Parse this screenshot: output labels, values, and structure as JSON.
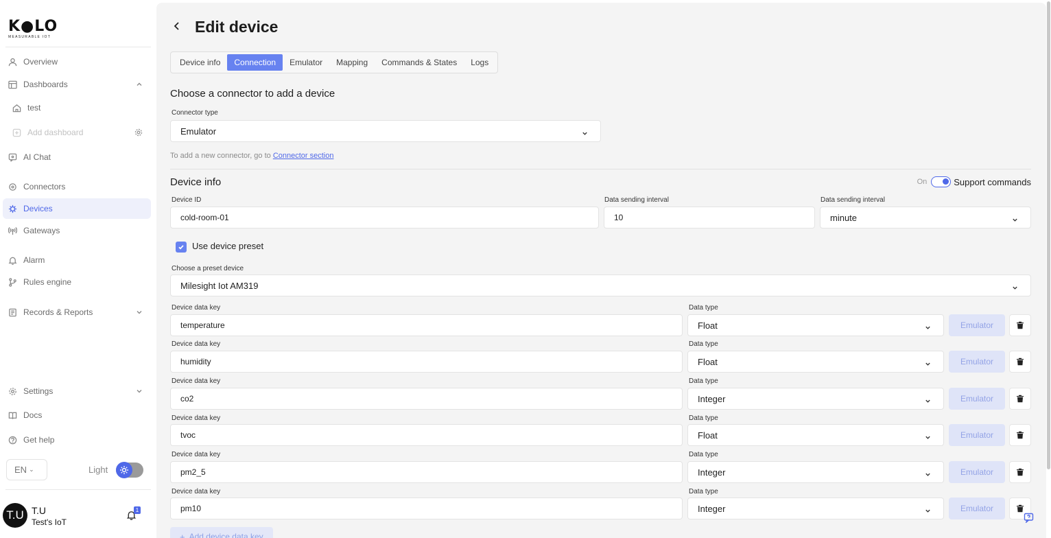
{
  "brand": {
    "name": "K●LO",
    "tagline": "MEASURABLE IOT"
  },
  "sidebar": {
    "items": [
      {
        "label": "Overview",
        "icon": "user-icon"
      },
      {
        "label": "Dashboards",
        "icon": "layout-icon"
      },
      {
        "label": "test",
        "icon": "home-icon"
      },
      {
        "label": "Add dashboard",
        "icon": "plus-square-icon"
      },
      {
        "label": "AI Chat",
        "icon": "chat-icon"
      },
      {
        "label": "Connectors",
        "icon": "link-icon"
      },
      {
        "label": "Devices",
        "icon": "chip-icon"
      },
      {
        "label": "Gateways",
        "icon": "antenna-icon"
      },
      {
        "label": "Alarm",
        "icon": "bell-icon"
      },
      {
        "label": "Rules engine",
        "icon": "branch-icon"
      },
      {
        "label": "Records & Reports",
        "icon": "report-icon"
      },
      {
        "label": "Settings",
        "icon": "gear-icon"
      },
      {
        "label": "Docs",
        "icon": "book-icon"
      },
      {
        "label": "Get help",
        "icon": "help-icon"
      }
    ],
    "language": "EN",
    "theme_label": "Light",
    "user": {
      "initials": "T.U",
      "name": "T.U",
      "org": "Test's IoT",
      "notifications": "1"
    }
  },
  "page": {
    "title": "Edit device"
  },
  "tabs": [
    "Device info",
    "Connection",
    "Emulator",
    "Mapping",
    "Commands & States",
    "Logs"
  ],
  "active_tab": "Connection",
  "connector": {
    "heading": "Choose a connector to add a device",
    "type_label": "Connector type",
    "type_value": "Emulator",
    "hint_prefix": "To add a new connector, go to ",
    "hint_link": "Connector section"
  },
  "device_info": {
    "heading": "Device info",
    "support_on": "On",
    "support_label": "Support commands",
    "id_label": "Device ID",
    "id_value": "cold-room-01",
    "interval_label": "Data sending interval",
    "interval_value": "10",
    "interval_unit_label": "Data sending interval",
    "interval_unit_value": "minute",
    "preset_checkbox_label": "Use device preset",
    "preset_label": "Choose a preset device",
    "preset_value": "Milesight Iot AM319"
  },
  "data_keys": {
    "key_label": "Device data key",
    "type_label": "Data type",
    "emulator_label": "Emulator",
    "rows": [
      {
        "key": "temperature",
        "type": "Float"
      },
      {
        "key": "humidity",
        "type": "Float"
      },
      {
        "key": "co2",
        "type": "Integer"
      },
      {
        "key": "tvoc",
        "type": "Float"
      },
      {
        "key": "pm2_5",
        "type": "Integer"
      },
      {
        "key": "pm10",
        "type": "Integer"
      }
    ],
    "add_label": "Add device data key"
  },
  "colors": {
    "accent": "#4f68e8",
    "tab_active": "#6782f0",
    "panel_bg": "#f4f4f4"
  }
}
